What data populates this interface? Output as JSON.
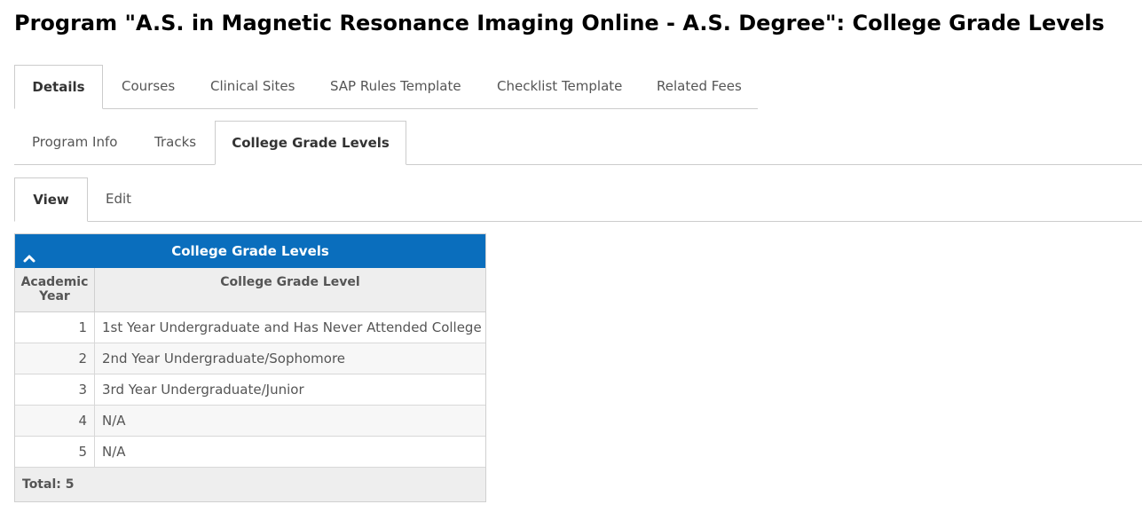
{
  "page": {
    "title": "Program \"A.S. in Magnetic Resonance Imaging Online - A.S. Degree\": College Grade Levels"
  },
  "main_tabs": {
    "details": "Details",
    "courses": "Courses",
    "clinical_sites": "Clinical Sites",
    "sap_rules": "SAP Rules Template",
    "checklist": "Checklist Template",
    "related_fees": "Related Fees"
  },
  "sub_tabs": {
    "program_info": "Program Info",
    "tracks": "Tracks",
    "college_grade_levels": "College Grade Levels"
  },
  "view_tabs": {
    "view": "View",
    "edit": "Edit"
  },
  "grid": {
    "title": "College Grade Levels",
    "header_color": "#0a6ebd",
    "col_academic_year": "Academic Year",
    "col_grade_level": "College Grade Level",
    "rows": [
      {
        "year": "1",
        "level": "1st Year Undergraduate and Has Never Attended College"
      },
      {
        "year": "2",
        "level": "2nd Year Undergraduate/Sophomore"
      },
      {
        "year": "3",
        "level": "3rd Year Undergraduate/Junior"
      },
      {
        "year": "4",
        "level": "N/A"
      },
      {
        "year": "5",
        "level": "N/A"
      }
    ],
    "total": "Total: 5"
  }
}
